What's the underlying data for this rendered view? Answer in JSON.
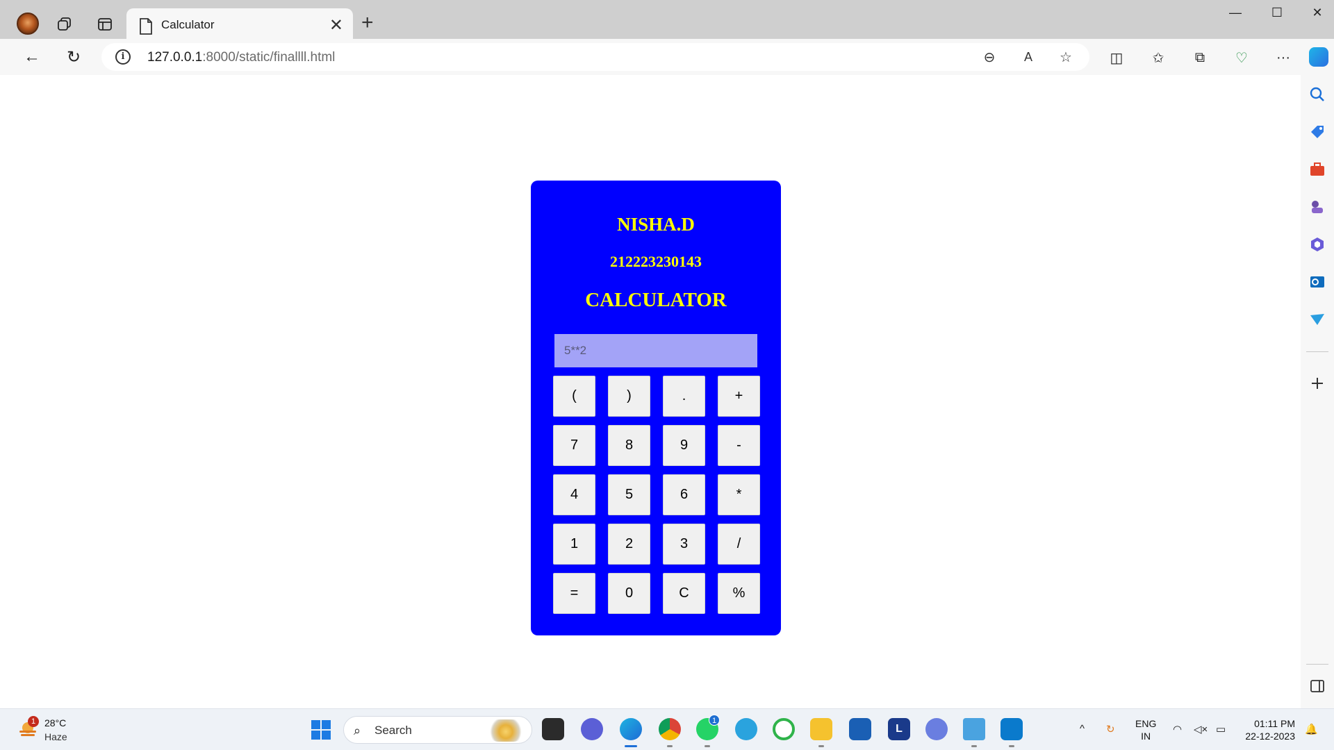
{
  "browser": {
    "tab_title": "Calculator",
    "tab_close_glyph": "✕",
    "new_tab_glyph": "+",
    "url_host": "127.0.0.1",
    "url_rest": ":8000/static/finallll.html",
    "window_controls": [
      "—",
      "☐",
      "✕"
    ]
  },
  "icons": {
    "back": "←",
    "refresh": "↻",
    "zoom": "⊖",
    "read_aloud": "A",
    "favorite": "☆",
    "split": "◫",
    "favorites": "✩",
    "collections": "⧉",
    "performance": "♡",
    "more": "···"
  },
  "calculator": {
    "name": "NISHA.D",
    "roll_number": "212223230143",
    "title": "CALCULATOR",
    "display_placeholder": "5**2",
    "keys": [
      "(",
      ")",
      ".",
      "+",
      "7",
      "8",
      "9",
      "-",
      "4",
      "5",
      "6",
      "*",
      "1",
      "2",
      "3",
      "/",
      "=",
      "0",
      "C",
      "%"
    ]
  },
  "taskbar": {
    "weather_temp": "28°C",
    "weather_condition": "Haze",
    "weather_badge": "1",
    "search_label": "Search",
    "whatsapp_badge": "1",
    "language_line1": "ENG",
    "language_line2": "IN",
    "time": "01:11 PM",
    "date": "22-12-2023"
  },
  "colors": {
    "calculator_bg": "#0000ff",
    "calculator_text": "#ffff00",
    "display_bg": "#a3a3f7",
    "key_bg": "#f0f0f0"
  }
}
